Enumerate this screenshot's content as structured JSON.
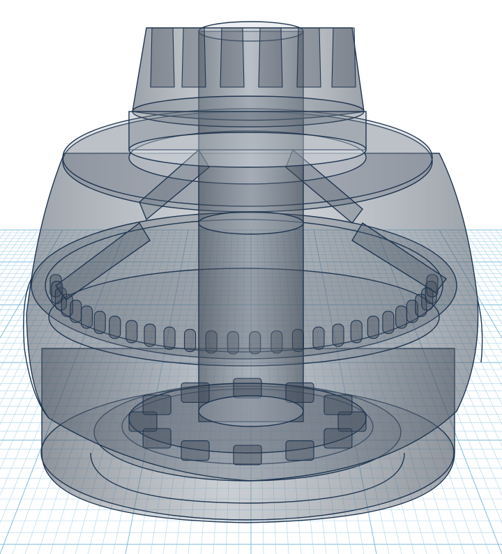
{
  "viewport": {
    "background_color": "#ffffff",
    "grid_color": "#a9d3ea",
    "grid_major_color": "#7fbcdc",
    "model_fill": "#5f6b78",
    "model_edge": "#1f3550",
    "model_highlight": "#e9edf2"
  },
  "scene": {
    "object": "translucent-gear-assembly",
    "workplane": "grid-workplane"
  }
}
